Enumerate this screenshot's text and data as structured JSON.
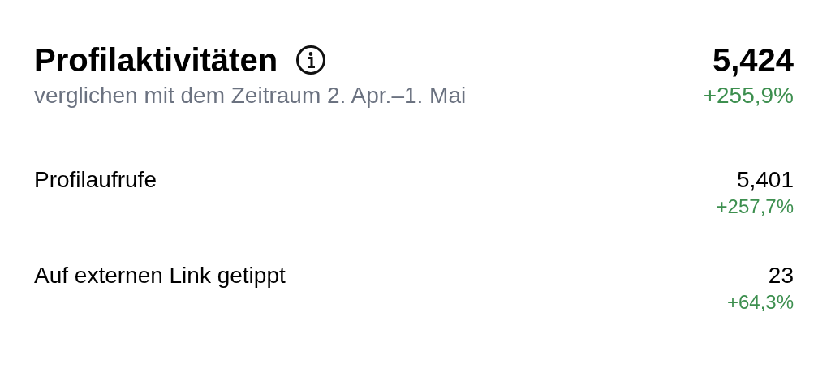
{
  "header": {
    "title": "Profilaktivitäten",
    "subtitle": "verglichen mit dem Zeitraum 2. Apr.–1. Mai",
    "value": "5,424",
    "change": "+255,9%"
  },
  "rows": [
    {
      "label": "Profilaufrufe",
      "value": "5,401",
      "change": "+257,7%"
    },
    {
      "label": "Auf externen Link getippt",
      "value": "23",
      "change": "+64,3%"
    }
  ]
}
